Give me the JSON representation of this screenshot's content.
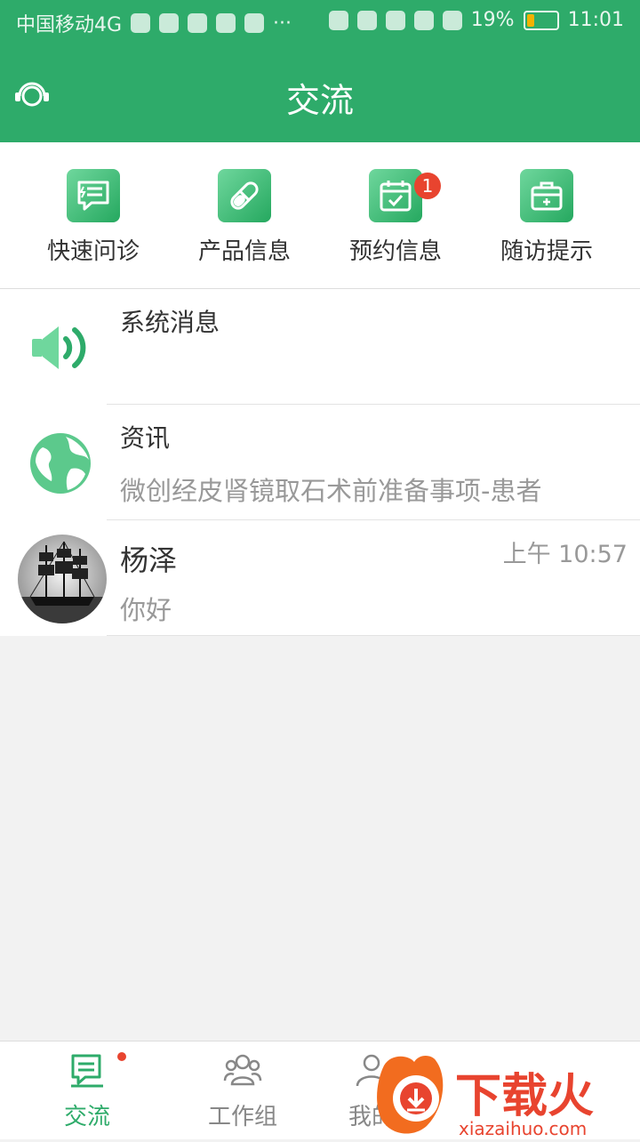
{
  "status_bar": {
    "carrier": "中国移动4G",
    "battery": "19%",
    "time": "11:01",
    "battery_level": 0.19
  },
  "header": {
    "title": "交流",
    "icon": "headset-icon"
  },
  "quick_actions": [
    {
      "label": "快速问诊",
      "icon": "chat-bubble-icon"
    },
    {
      "label": "产品信息",
      "icon": "capsule-icon"
    },
    {
      "label": "预约信息",
      "icon": "calendar-check-icon",
      "badge": "1"
    },
    {
      "label": "随访提示",
      "icon": "medical-kit-icon"
    }
  ],
  "messages": [
    {
      "title": "系统消息",
      "subtitle": "",
      "time": "",
      "icon": "speaker-icon"
    },
    {
      "title": "资讯",
      "subtitle": "微创经皮肾镜取石术前准备事项-患者",
      "time": "",
      "icon": "globe-icon"
    },
    {
      "title": "杨泽",
      "subtitle": "你好",
      "time": "上午 10:57",
      "icon": "avatar"
    }
  ],
  "tabs": [
    {
      "label": "交流",
      "icon": "chat-tab-icon",
      "active": true
    },
    {
      "label": "工作组",
      "icon": "group-icon",
      "active": false
    },
    {
      "label": "我的",
      "icon": "profile-icon",
      "active": false
    }
  ],
  "watermark": {
    "brand": "下载火",
    "site": "xiazaihuo.com"
  },
  "colors": {
    "primary": "#2eab6a",
    "badge": "#e8442f",
    "text": "#333333",
    "muted": "#999999"
  }
}
